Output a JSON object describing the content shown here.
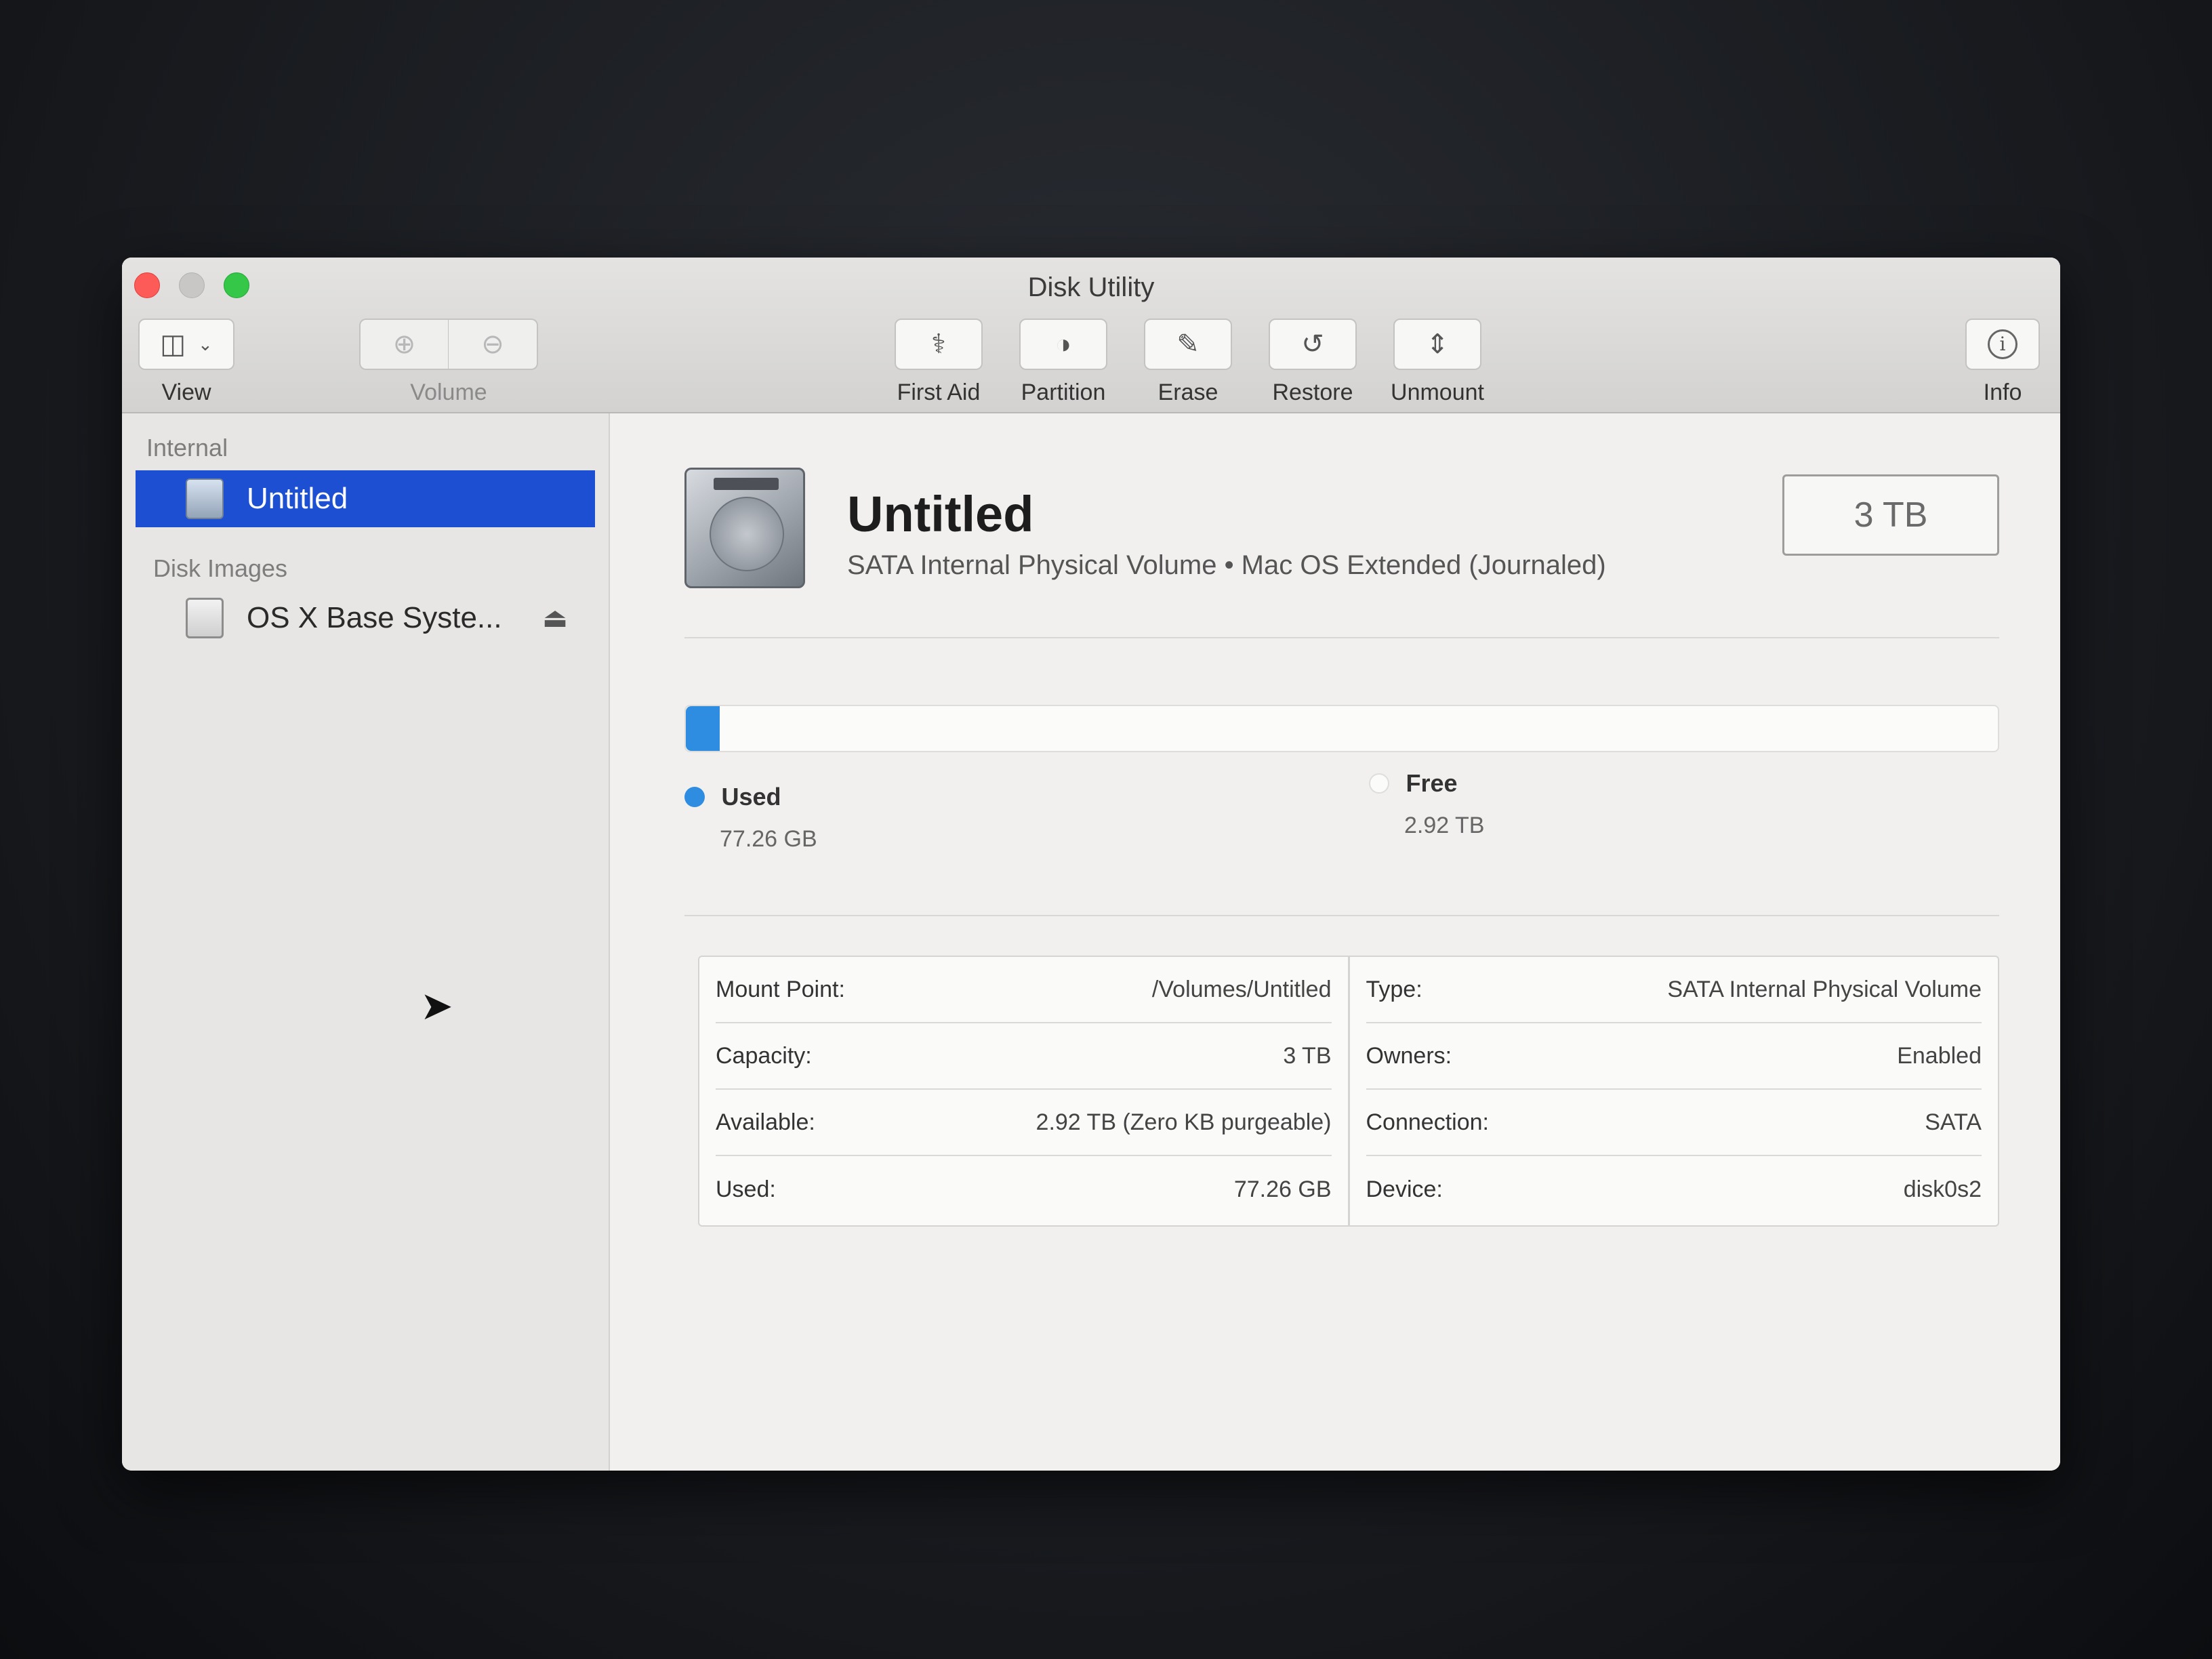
{
  "window": {
    "title": "Disk Utility"
  },
  "toolbar": {
    "view_label": "View",
    "volume_label": "Volume",
    "actions": [
      {
        "label": "First Aid",
        "icon": "stethoscope-icon",
        "glyph": "⚕"
      },
      {
        "label": "Partition",
        "icon": "partition-icon",
        "glyph": "◑"
      },
      {
        "label": "Erase",
        "icon": "erase-icon",
        "glyph": "✎"
      },
      {
        "label": "Restore",
        "icon": "restore-icon",
        "glyph": "↺"
      },
      {
        "label": "Unmount",
        "icon": "unmount-icon",
        "glyph": "⇕"
      }
    ],
    "info_label": "Info",
    "info_glyph": "i"
  },
  "sidebar": {
    "internal_header": "Internal",
    "internal_items": [
      {
        "label": "Untitled",
        "selected": true
      }
    ],
    "disk_images_header": "Disk Images",
    "disk_image_items": [
      {
        "label": "OS X Base Syste...",
        "eject_glyph": "⏏"
      }
    ]
  },
  "volume": {
    "name": "Untitled",
    "description": "SATA Internal Physical Volume • Mac OS Extended (Journaled)",
    "size_badge": "3 TB"
  },
  "usage": {
    "used_fraction": 0.026,
    "used_color": "#2e8de1",
    "free_color": "#fbfbfa",
    "used_label": "Used",
    "used_value": "77.26 GB",
    "free_label": "Free",
    "free_value": "2.92 TB"
  },
  "details": {
    "left": [
      {
        "key": "Mount Point:",
        "value": "/Volumes/Untitled"
      },
      {
        "key": "Capacity:",
        "value": "3 TB"
      },
      {
        "key": "Available:",
        "value": "2.92 TB (Zero KB purgeable)"
      },
      {
        "key": "Used:",
        "value": "77.26 GB"
      }
    ],
    "right": [
      {
        "key": "Type:",
        "value": "SATA Internal Physical Volume"
      },
      {
        "key": "Owners:",
        "value": "Enabled"
      },
      {
        "key": "Connection:",
        "value": "SATA"
      },
      {
        "key": "Device:",
        "value": "disk0s2"
      }
    ]
  }
}
